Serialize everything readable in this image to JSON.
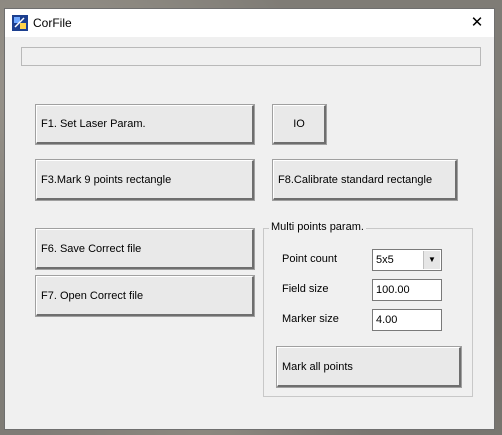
{
  "window": {
    "title": "CorFile",
    "close_glyph": "✕",
    "status_text": ""
  },
  "buttons": {
    "set_laser": "F1. Set Laser Param.",
    "io": "IO",
    "mark9": "F3.Mark 9 points rectangle",
    "calibrate": "F8.Calibrate standard rectangle",
    "save_correct": "F6. Save Correct file",
    "open_correct": "F7. Open Correct file",
    "mark_all": "Mark all points"
  },
  "multi_points": {
    "group_title": "Multi points param.",
    "point_count_label": "Point count",
    "point_count_value": "5x5",
    "field_size_label": "Field size",
    "field_size_value": "100.00",
    "marker_size_label": "Marker size",
    "marker_size_value": "4.00"
  },
  "icons": {
    "app": "app-icon",
    "close": "close-icon",
    "dropdown": "chevron-down-icon"
  },
  "colors": {
    "window_bg": "#f0f0f0",
    "titlebar_bg": "#ffffff",
    "button_face": "#e9e9e9"
  }
}
